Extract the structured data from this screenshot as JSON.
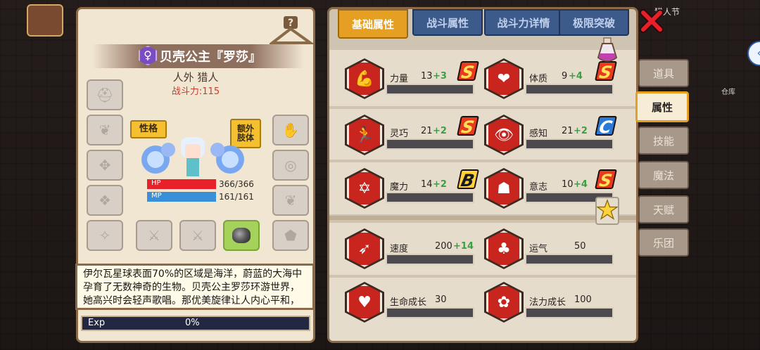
{
  "hud": {
    "right_label": "猎人节",
    "cangku_label": "仓库",
    "edge_button_icon": "double-chevron-left-icon"
  },
  "character": {
    "gender_icon": "female-icon",
    "name": "贝壳公主『罗莎』",
    "title": "人外 猎人",
    "power": "战斗力:115",
    "tag_personality": "性格",
    "tag_extra_limb": "额外肢体",
    "hp_label": "HP",
    "hp_value": "366/366",
    "hp_fraction": 1.0,
    "mp_label": "MP",
    "mp_value": "161/161",
    "mp_fraction": 1.0,
    "description": "伊尔瓦星球表面70%的区域是海洋，蔚蓝的大海中孕育了无数神奇的生物。贝壳公主罗莎环游世界，她高兴时会轻声歌唱。那优美旋律让人内心平和，忘记战争",
    "exp_label": "Exp",
    "exp_value": "0%"
  },
  "equipment_slots": [
    {
      "name": "helmet-slot-icon"
    },
    {
      "name": "amulet-slot-icon"
    },
    {
      "name": "cloak-slot-icon"
    },
    {
      "name": "armor-slot-icon"
    },
    {
      "name": "bracer-slot-icon"
    },
    {
      "name": "gloves-slot-icon"
    },
    {
      "name": "ring-slot-icon"
    },
    {
      "name": "boots-slot-icon"
    },
    {
      "name": "tool-slot-icon"
    },
    {
      "name": "weapon-slot-icon"
    },
    {
      "name": "weapon-slot-icon"
    },
    {
      "name": "gem-slot-icon"
    },
    {
      "name": "shield-slot-icon"
    }
  ],
  "tabs": [
    {
      "label": "基础属性",
      "active": true
    },
    {
      "label": "战斗属性",
      "active": false
    },
    {
      "label": "战斗力详情",
      "active": false
    },
    {
      "label": "极限突破",
      "active": false
    }
  ],
  "stats": [
    {
      "name": "力量",
      "value": "13",
      "bonus": "+3",
      "grade": "S",
      "icon": "strength-arm-icon"
    },
    {
      "name": "体质",
      "value": "9",
      "bonus": "+4",
      "grade": "S",
      "icon": "constitution-body-icon"
    },
    {
      "name": "灵巧",
      "value": "21",
      "bonus": "+2",
      "grade": "S",
      "icon": "dexterity-runner-icon"
    },
    {
      "name": "感知",
      "value": "21",
      "bonus": "+2",
      "grade": "C",
      "icon": "perception-eye-icon"
    },
    {
      "name": "魔力",
      "value": "14",
      "bonus": "+2",
      "grade": "B",
      "icon": "magic-hexagram-icon"
    },
    {
      "name": "意志",
      "value": "10",
      "bonus": "+4",
      "grade": "S",
      "icon": "will-head-icon"
    },
    {
      "name": "速度",
      "value": "200",
      "bonus": "+14",
      "grade": "",
      "icon": "speed-wing-icon"
    },
    {
      "name": "运气",
      "value": "50",
      "bonus": "",
      "grade": "",
      "icon": "luck-clover-icon"
    },
    {
      "name": "生命成长",
      "value": "30",
      "bonus": "",
      "grade": "",
      "icon": "life-growth-heart-icon"
    },
    {
      "name": "法力成长",
      "value": "100",
      "bonus": "",
      "grade": "",
      "icon": "mana-growth-flower-icon"
    }
  ],
  "side_menu": [
    {
      "label": "道具",
      "active": false
    },
    {
      "label": "属性",
      "active": true
    },
    {
      "label": "技能",
      "active": false
    },
    {
      "label": "魔法",
      "active": false
    },
    {
      "label": "天赋",
      "active": false
    },
    {
      "label": "乐团",
      "active": false
    }
  ],
  "colors": {
    "tab_active": "#e5a024",
    "tab_inactive": "#3c5a8a",
    "hp_bar": "#e8202a",
    "mp_bar": "#3a90d8",
    "bonus_green": "#3aa044",
    "power_red": "#d03a2a"
  }
}
